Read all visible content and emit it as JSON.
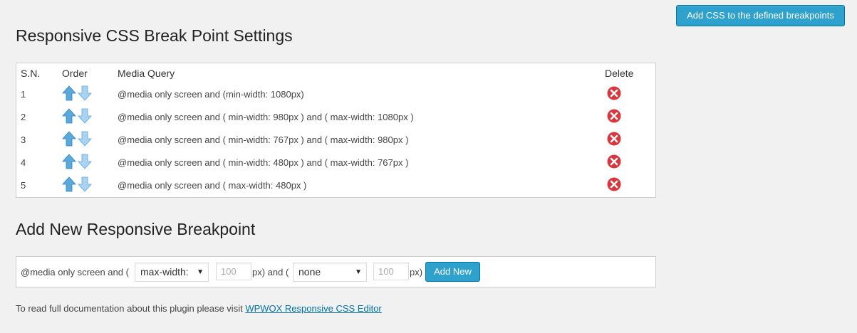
{
  "top_button": {
    "label": "Add CSS to the defined breakpoints"
  },
  "settings": {
    "title": "Responsive CSS Break Point Settings",
    "columns": {
      "sn": "S.N.",
      "order": "Order",
      "media_query": "Media Query",
      "delete": "Delete"
    },
    "rows": [
      {
        "sn": "1",
        "query": "@media only screen and (min-width: 1080px)"
      },
      {
        "sn": "2",
        "query": "@media only screen and ( min-width: 980px ) and ( max-width: 1080px )"
      },
      {
        "sn": "3",
        "query": "@media only screen and ( min-width: 767px ) and ( max-width: 980px )"
      },
      {
        "sn": "4",
        "query": "@media only screen and ( min-width: 480px ) and ( max-width: 767px )"
      },
      {
        "sn": "5",
        "query": "@media only screen and ( max-width: 480px )"
      }
    ]
  },
  "add_new": {
    "title": "Add New Responsive Breakpoint",
    "prefix": "@media only screen and (",
    "select1_value": "max-width:",
    "input1_placeholder": "100",
    "mid_text": "px) and (",
    "select2_value": "none",
    "input2_placeholder": "100",
    "suffix": "px)",
    "button_label": "Add New"
  },
  "footer": {
    "text": "To read full documentation about this plugin please visit ",
    "link_text": "WPWOX Responsive CSS Editor"
  },
  "colors": {
    "background": "#f1f1f1",
    "primary_button": "#2ea2cc",
    "delete_icon": "#d9363e",
    "arrow": "#5aa9dd",
    "link": "#0074a2"
  },
  "icons": {
    "order_up": "up-arrow-icon",
    "order_down": "down-arrow-icon",
    "delete": "delete-icon"
  }
}
